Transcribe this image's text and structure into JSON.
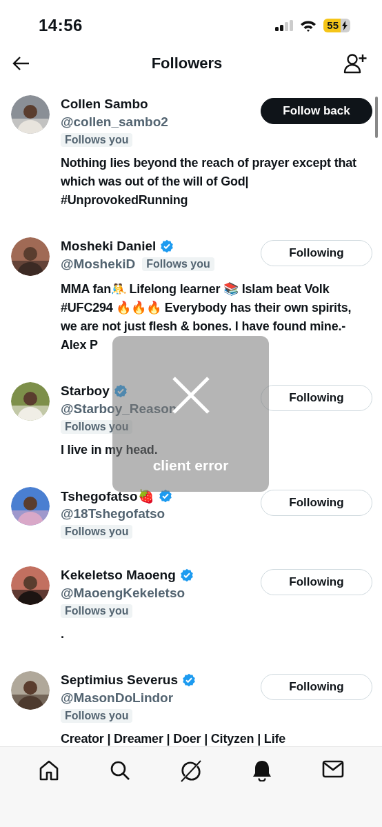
{
  "status_bar": {
    "time": "14:56",
    "battery": "55"
  },
  "header": {
    "title": "Followers"
  },
  "followers": [
    {
      "name": "Collen Sambo",
      "verified": false,
      "handle": "@collen_sambo2",
      "follows_you": "Follows you",
      "handle_inline": false,
      "bio": "Nothing lies beyond the reach of prayer except that which was out of the will of God| #UnprovokedRunning",
      "button": {
        "label": "Follow back",
        "following": false
      }
    },
    {
      "name": "Mosheki Daniel",
      "verified": true,
      "handle": "@MoshekiD",
      "follows_you": "Follows you",
      "handle_inline": true,
      "bio": "MMA fan🤼 Lifelong learner 📚 Islam beat Volk #UFC294 🔥🔥🔥 Everybody has their own spirits, we are not just flesh & bones. I have found mine.- Alex P",
      "button": {
        "label": "Following",
        "following": true
      }
    },
    {
      "name": "Starboy",
      "verified": true,
      "handle": "@Starboy_Reason",
      "follows_you": "Follows you",
      "handle_inline": false,
      "bio": "I live in my head.",
      "button": {
        "label": "Following",
        "following": true
      }
    },
    {
      "name": "Tshegofatso🍓",
      "verified": true,
      "handle": "@18Tshegofatso",
      "follows_you": "Follows you",
      "handle_inline": false,
      "button": {
        "label": "Following",
        "following": true
      }
    },
    {
      "name": "Kekeletso Maoeng",
      "verified": true,
      "handle": "@MaoengKekeletso",
      "follows_you": "Follows you",
      "handle_inline": false,
      "bio": ".",
      "button": {
        "label": "Following",
        "following": true
      }
    },
    {
      "name": "Septimius Severus",
      "verified": true,
      "handle": "@MasonDoLindor",
      "follows_you": "Follows you",
      "handle_inline": false,
      "bio": "Creator | Dreamer | Doer | Cityzen | Life",
      "button": {
        "label": "Following",
        "following": true
      }
    }
  ],
  "toast": {
    "message": "client error"
  },
  "bottom_nav": [
    {
      "kind": "home"
    },
    {
      "kind": "search"
    },
    {
      "kind": "grok"
    },
    {
      "kind": "bell"
    },
    {
      "kind": "mail"
    }
  ]
}
